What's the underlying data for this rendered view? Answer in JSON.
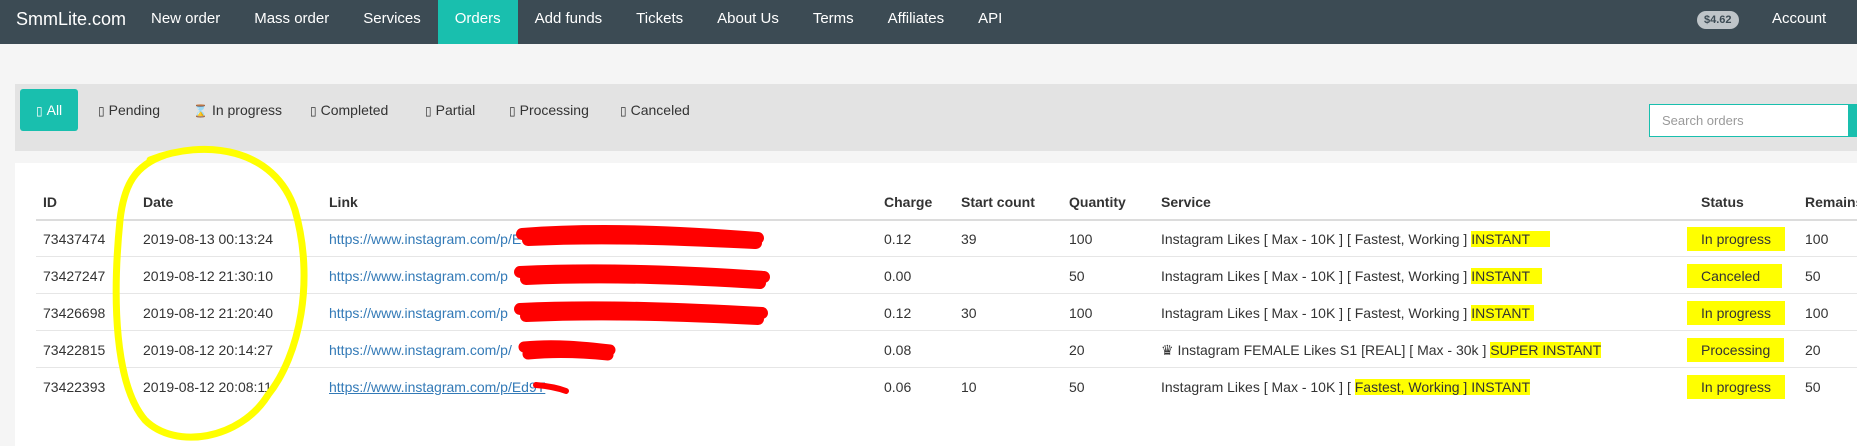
{
  "navbar": {
    "brand": "SmmLite.com",
    "items": [
      {
        "label": "New order",
        "active": false
      },
      {
        "label": "Mass order",
        "active": false
      },
      {
        "label": "Services",
        "active": false
      },
      {
        "label": "Orders",
        "active": true
      },
      {
        "label": "Add funds",
        "active": false
      },
      {
        "label": "Tickets",
        "active": false
      },
      {
        "label": "About Us",
        "active": false
      },
      {
        "label": "Terms",
        "active": false
      },
      {
        "label": "Affiliates",
        "active": false
      },
      {
        "label": "API",
        "active": false
      }
    ],
    "balance": "$4.62",
    "account": "Account"
  },
  "filters": {
    "tabs": [
      {
        "label": "All",
        "icon": "list-icon",
        "active": true
      },
      {
        "label": "Pending",
        "icon": "clock-icon",
        "active": false
      },
      {
        "label": "In progress",
        "icon": "hourglass-icon",
        "active": false
      },
      {
        "label": "Completed",
        "icon": "check-icon",
        "active": false
      },
      {
        "label": "Partial",
        "icon": "partial-icon",
        "active": false
      },
      {
        "label": "Processing",
        "icon": "refresh-icon",
        "active": false
      },
      {
        "label": "Canceled",
        "icon": "ban-icon",
        "active": false
      }
    ],
    "search_placeholder": "Search orders"
  },
  "table": {
    "headers": {
      "id": "ID",
      "date": "Date",
      "link": "Link",
      "charge": "Charge",
      "start_count": "Start count",
      "quantity": "Quantity",
      "service": "Service",
      "status": "Status",
      "remains": "Remains"
    },
    "rows": [
      {
        "id": "73437474",
        "date": "2019-08-13 00:13:24",
        "link": "https://www.instagram.com/p/E",
        "charge": "0.12",
        "start_count": "39",
        "quantity": "100",
        "service": "Instagram Likes [ Max - 10K ] [ Fastest, Working ] ",
        "service_hl": "INSTANT",
        "status": "In progress",
        "remains": "100"
      },
      {
        "id": "73427247",
        "date": "2019-08-12 21:30:10",
        "link": "https://www.instagram.com/p",
        "charge": "0.00",
        "start_count": "",
        "quantity": "50",
        "service": "Instagram Likes [ Max - 10K ] [ Fastest, Working ] ",
        "service_hl": "INSTANT",
        "status": "Canceled",
        "remains": "50"
      },
      {
        "id": "73426698",
        "date": "2019-08-12 21:20:40",
        "link": "https://www.instagram.com/p",
        "charge": "0.12",
        "start_count": "30",
        "quantity": "100",
        "service": "Instagram Likes [ Max - 10K ] [ Fastest, Working ] ",
        "service_hl": "INSTANT",
        "status": "In progress",
        "remains": "100"
      },
      {
        "id": "73422815",
        "date": "2019-08-12 20:14:27",
        "link": "https://www.instagram.com/p/",
        "charge": "0.08",
        "start_count": "",
        "quantity": "20",
        "service": "♛ Instagram FEMALE Likes S1 [REAL] [ Max - 30k ] ",
        "service_hl": "SUPER INSTANT",
        "status": "Processing",
        "remains": "20"
      },
      {
        "id": "73422393",
        "date": "2019-08-12 20:08:11",
        "link": "https://www.instagram.com/p/Ed9T",
        "charge": "0.06",
        "start_count": "10",
        "quantity": "50",
        "service": "Instagram Likes [ Max - 10K ] ",
        "service_hl": "Fastest, Working ] INSTANT",
        "service_hl_prefix": "[ ",
        "status": "In progress",
        "remains": "50"
      }
    ]
  },
  "annotations": {
    "highlight_color": "#ffff00",
    "redaction_color": "#ff0000"
  }
}
